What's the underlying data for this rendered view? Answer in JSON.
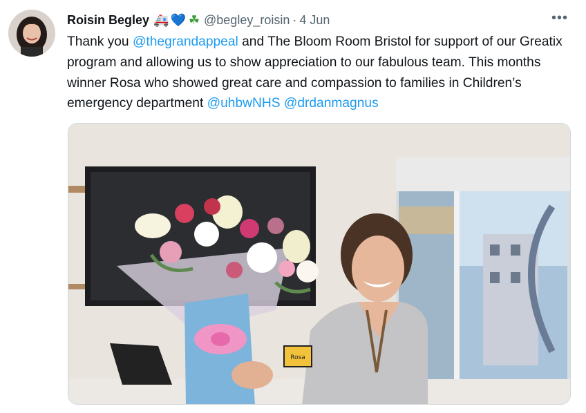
{
  "tweet": {
    "author": {
      "name": "Roisin Begley",
      "emojis": [
        "🚑",
        "💙",
        "☘"
      ],
      "handle": "@begley_roisin",
      "separator": "·",
      "date": "4 Jun",
      "avatar_icon": "profile-photo"
    },
    "more_label": "•••",
    "text": {
      "t1": "Thank you ",
      "mention1": "@thegrandappeal",
      "t2": " and The Bloom Room Bristol for support of our Greatix program and allowing us to show appreciation to our fabulous team. This months winner Rosa who showed great care and compassion to families in Children’s emergency department ",
      "mention2": "@uhbwNHS",
      "t3": " ",
      "mention3": "@drdanmagnus"
    },
    "media": {
      "type": "photo",
      "badge_text": "Rosa"
    }
  },
  "colors": {
    "link": "#1d9bf0",
    "secondary_text": "#536471",
    "border": "#cfd9de"
  }
}
